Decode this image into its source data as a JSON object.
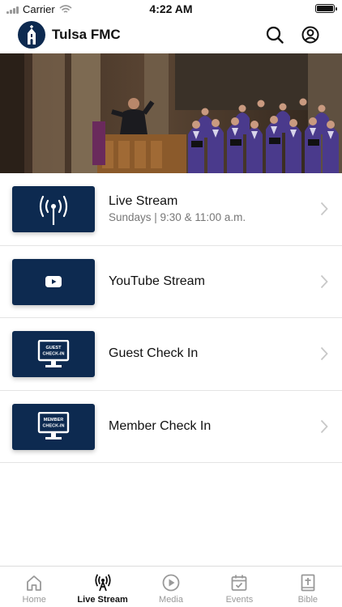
{
  "status_bar": {
    "carrier": "Carrier",
    "time": "4:22 AM"
  },
  "header": {
    "title": "Tulsa FMC",
    "logo_icon": "church-icon",
    "search_icon": "search-icon",
    "account_icon": "user-circle-icon"
  },
  "hero": {
    "image": "church-choir-photo"
  },
  "items": [
    {
      "title": "Live Stream",
      "subtitle": "Sundays | 9:30 & 11:00 a.m.",
      "icon": "broadcast-tower-icon"
    },
    {
      "title": "YouTube Stream",
      "subtitle": "",
      "icon": "youtube-play-icon"
    },
    {
      "title": "Guest Check In",
      "subtitle": "",
      "icon": "monitor-icon",
      "screen_text": [
        "GUEST",
        "CHECK-IN"
      ]
    },
    {
      "title": "Member Check In",
      "subtitle": "",
      "icon": "monitor-icon",
      "screen_text": [
        "MEMBER",
        "CHECK-IN"
      ]
    }
  ],
  "tabs": [
    {
      "label": "Home",
      "icon": "home-icon"
    },
    {
      "label": "Live Stream",
      "icon": "broadcast-tower-icon",
      "active": true
    },
    {
      "label": "Media",
      "icon": "play-circle-icon"
    },
    {
      "label": "Events",
      "icon": "calendar-check-icon"
    },
    {
      "label": "Bible",
      "icon": "bible-icon"
    }
  ],
  "colors": {
    "brand": "#0d2a50",
    "text": "#111111",
    "muted": "#777777",
    "divider": "#e4e4e4"
  }
}
